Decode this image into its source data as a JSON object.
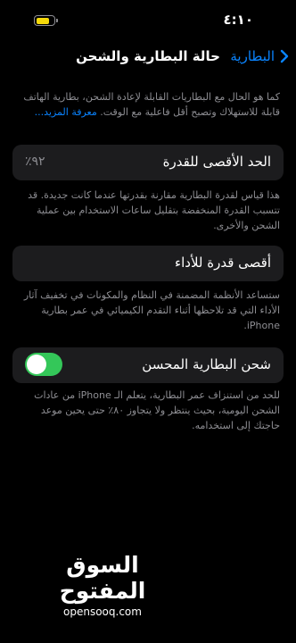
{
  "status_bar": {
    "time": "٤:١٠",
    "battery_color": "#f5d90a",
    "battery_level": 0.75
  },
  "nav": {
    "title": "حالة البطارية والشحن",
    "back_label": "البطارية",
    "back_icon": "chevron-left-icon"
  },
  "intro": {
    "text": "كما هو الحال مع البطاريات القابلة لإعادة الشحن، بطارية الهاتف قابلة للاستهلاك وتصبح أقل فاعلية مع الوقت.",
    "link": "معرفة المزيد..."
  },
  "max_capacity": {
    "label": "الحد الأقصى للقدرة",
    "value": "٩٢٪",
    "footer": "هذا قياس لقدرة البطارية مقارنة بقدرتها عندما كانت جديدة. قد تتسبب القدرة المنخفضة بتقليل ساعات الاستخدام بين عملية الشحن والأخرى."
  },
  "peak_performance": {
    "label": "أقصى قدرة للأداء",
    "footer": "ستساعد الأنظمة المضمنة في النظام والمكونات في تخفيف آثار الأداء التي قد تلاحظها أثناء التقدم الكيميائي في عمر بطارية iPhone."
  },
  "optimized_charging": {
    "label": "شحن البطارية المحسن",
    "enabled": true,
    "toggle_color": "#34c759",
    "footer": "للحد من استنزاف عمر البطارية، يتعلم الـ iPhone من عادات الشحن اليومية، بحيث ينتظر ولا يتجاوز ٨٠٪ حتى يحين موعد حاجتك إلى استخدامه."
  },
  "watermark": {
    "arabic": "السوق المفتوح",
    "latin": "opensooq.com"
  }
}
